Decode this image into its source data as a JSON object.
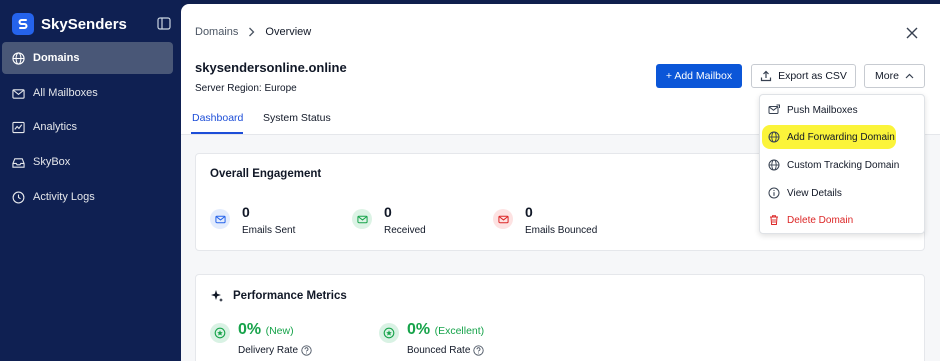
{
  "brand": {
    "name": "SkySenders",
    "accent": "#2563eb"
  },
  "sidebar": {
    "items": [
      {
        "label": "Domains",
        "icon": "globe-icon",
        "active": true
      },
      {
        "label": "All Mailboxes",
        "icon": "mail-icon",
        "active": false
      },
      {
        "label": "Analytics",
        "icon": "analytics-icon",
        "active": false
      },
      {
        "label": "SkyBox",
        "icon": "inbox-icon",
        "active": false
      },
      {
        "label": "Activity Logs",
        "icon": "history-icon",
        "active": false
      }
    ]
  },
  "breadcrumb": {
    "parent": "Domains",
    "separator": ">",
    "current": "Overview"
  },
  "domain": {
    "name": "skysendersonline.online",
    "region": "Server Region: Europe"
  },
  "actions": {
    "add_mailbox": "+ Add Mailbox",
    "export_csv": "Export as CSV",
    "more": "More"
  },
  "tabs": [
    {
      "label": "Dashboard",
      "active": true
    },
    {
      "label": "System Status",
      "active": false
    }
  ],
  "engagement": {
    "title": "Overall Engagement",
    "stats": [
      {
        "value": "0",
        "label": "Emails Sent",
        "icon": "mail-icon"
      },
      {
        "value": "0",
        "label": "Received",
        "icon": "mail-received-icon"
      },
      {
        "value": "0",
        "label": "Emails Bounced",
        "icon": "mail-bounced-icon"
      }
    ]
  },
  "performance": {
    "title": "Performance Metrics",
    "metrics": [
      {
        "value": "0%",
        "tag": "(New)",
        "label": "Delivery Rate"
      },
      {
        "value": "0%",
        "tag": "(Excellent)",
        "label": "Bounced Rate"
      }
    ]
  },
  "more_menu": {
    "items": [
      {
        "label": "Push Mailboxes",
        "icon": "push-mail-icon"
      },
      {
        "label": "Add Forwarding Domain",
        "icon": "globe-icon",
        "highlighted": true
      },
      {
        "label": "Custom Tracking Domain",
        "icon": "globe-icon"
      },
      {
        "label": "View Details",
        "icon": "info-icon"
      },
      {
        "label": "Delete Domain",
        "icon": "trash-icon",
        "danger": true
      }
    ]
  },
  "colors": {
    "sidebar_bg": "#0f2052",
    "primary": "#0b56d8",
    "success": "#16a34a",
    "danger": "#dc2626",
    "highlight": "#fbf43a"
  }
}
